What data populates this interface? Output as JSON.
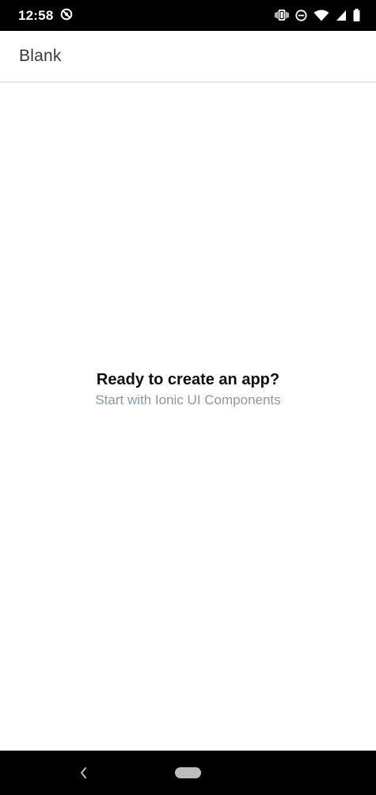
{
  "status_bar": {
    "time": "12:58",
    "icons": [
      "sync-icon",
      "vibrate-icon",
      "do-not-disturb-icon",
      "wifi-icon",
      "signal-icon",
      "battery-icon"
    ]
  },
  "toolbar": {
    "title": "Blank"
  },
  "content": {
    "title": "Ready to create an app?",
    "subtitle": "Start with Ionic UI Components"
  },
  "nav_bar": {
    "icons": [
      "back-icon",
      "home-pill-icon"
    ]
  },
  "colors": {
    "status_bar_bg": "#000000",
    "toolbar_bg": "#ffffff",
    "title_text": "#111111",
    "subtitle_text": "#8a98ad"
  }
}
